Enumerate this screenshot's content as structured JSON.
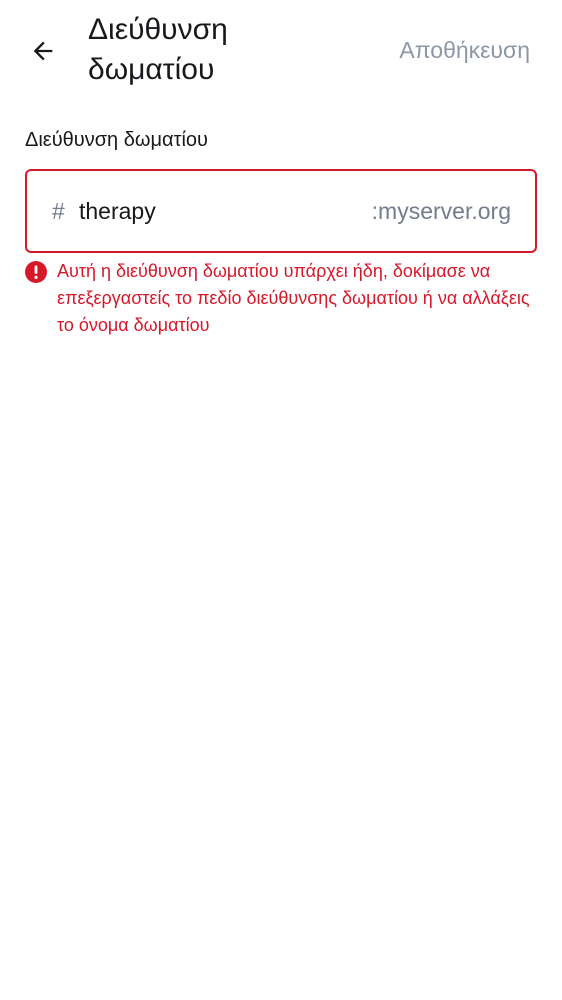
{
  "header": {
    "title": "Διεύθυνση δωματίου",
    "save_label": "Αποθήκευση",
    "back_icon": "arrow-left-icon"
  },
  "form": {
    "label": "Διεύθυνση δωματίου",
    "prefix": "#",
    "value": "therapy",
    "suffix": ":myserver.org",
    "error_icon": "error-circle-icon",
    "error_message": "Αυτή η διεύθυνση δωματίου υπάρχει ήδη, δοκίμασε να επεξεργαστείς το πεδίο διεύθυνσης δωματίου ή να αλλάξεις το όνομα δωματίου"
  },
  "colors": {
    "error": "#d51928",
    "muted": "#737d8c",
    "disabled_action": "#8d97a5",
    "text": "#17191c"
  }
}
